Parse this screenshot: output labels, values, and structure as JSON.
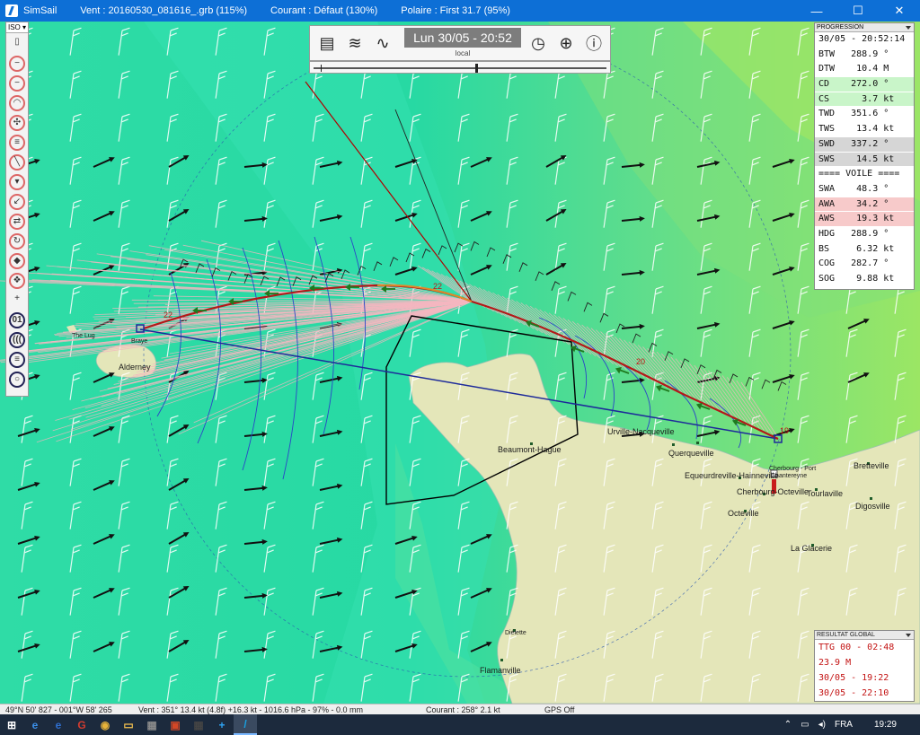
{
  "window": {
    "app_name": "SimSail",
    "wind_file": "Vent : 20160530_081616_.grb (115%)",
    "current": "Courant : Défaut (130%)",
    "polar": "Polaire : First 31.7 (95%)",
    "minimize_glyph": "—",
    "maximize_glyph": "☐",
    "close_glyph": "✕"
  },
  "left_toolbar": {
    "mode_label": "ISO",
    "mode_glyph": "▾",
    "tools": [
      {
        "name": "phone-icon",
        "glyph": "▯"
      },
      {
        "name": "stop-icon",
        "glyph": "−"
      },
      {
        "name": "minus-icon",
        "glyph": "−"
      },
      {
        "name": "speedometer-icon",
        "glyph": "◠"
      },
      {
        "name": "fan-icon",
        "glyph": "✣"
      },
      {
        "name": "windsock-icon",
        "glyph": "≡"
      },
      {
        "name": "pencil-icon",
        "glyph": "╲"
      },
      {
        "name": "cup-icon",
        "glyph": "▾"
      },
      {
        "name": "arrow-diagonal-icon",
        "glyph": "↙"
      },
      {
        "name": "refresh-icon",
        "glyph": "⇄"
      },
      {
        "name": "recycle-icon",
        "glyph": "↻"
      },
      {
        "name": "diamond-icon",
        "glyph": "◆"
      },
      {
        "name": "palette-icon",
        "glyph": "❖"
      },
      {
        "name": "plus-icon",
        "glyph": "+"
      },
      {
        "name": "zero-one-icon",
        "glyph": "01"
      },
      {
        "name": "signal-icon",
        "glyph": "((("
      },
      {
        "name": "stripes-icon",
        "glyph": "≡"
      },
      {
        "name": "ellipse-icon",
        "glyph": "○"
      }
    ]
  },
  "top_toolbar": {
    "date": "Lun 30/05 - 20:52",
    "tz": "local",
    "tools": [
      {
        "name": "clipboard-icon",
        "glyph": "▤"
      },
      {
        "name": "wind-icon",
        "glyph": "≋"
      },
      {
        "name": "waves-icon",
        "glyph": "∿"
      },
      {
        "name": "clock-icon",
        "glyph": "◷"
      },
      {
        "name": "globe-icon",
        "glyph": "⊕"
      },
      {
        "name": "info-icon",
        "glyph": "ⓘ"
      }
    ]
  },
  "progression": {
    "title": "PROGRESSION",
    "time": "30/05 - 20:52:14",
    "rows": [
      {
        "text": "BTW   288.9 °",
        "tone": "white"
      },
      {
        "text": "DTW    10.4 M",
        "tone": "white"
      },
      {
        "text": "CD    272.0 °",
        "tone": "green"
      },
      {
        "text": "CS      3.7 kt",
        "tone": "green"
      },
      {
        "text": "TWD   351.6 °",
        "tone": "white"
      },
      {
        "text": "TWS    13.4 kt",
        "tone": "white"
      },
      {
        "text": "SWD   337.2 °",
        "tone": "grey"
      },
      {
        "text": "SWS    14.5 kt",
        "tone": "grey"
      },
      {
        "text": "==== VOILE ====",
        "tone": "white"
      },
      {
        "text": "SWA    48.3 °",
        "tone": "white"
      },
      {
        "text": "AWA    34.2 °",
        "tone": "pink"
      },
      {
        "text": "AWS    19.3 kt",
        "tone": "pink"
      },
      {
        "text": "HDG   288.9 °",
        "tone": "white"
      },
      {
        "text": "BS     6.32 kt",
        "tone": "white"
      },
      {
        "text": "COG   282.7 °",
        "tone": "white"
      },
      {
        "text": "SOG    9.88 kt",
        "tone": "white"
      }
    ]
  },
  "results": {
    "title": "RESULTAT GLOBAL",
    "rows": [
      "TTG 00 - 02:48",
      "23.9 M",
      "30/05 - 19:22",
      "30/05 - 22:10"
    ]
  },
  "map_labels": [
    {
      "name": "label-alderney",
      "text": "Alderney",
      "cls": ""
    },
    {
      "name": "label-the-lug",
      "text": "The Lug",
      "cls": "small"
    },
    {
      "name": "label-braye",
      "text": "Braye",
      "cls": "small"
    },
    {
      "name": "label-beaumont-hague",
      "text": "Beaumont-Hague",
      "cls": ""
    },
    {
      "name": "label-urville",
      "text": "Urville-Nacqueville",
      "cls": ""
    },
    {
      "name": "label-querqueville",
      "text": "Querqueville",
      "cls": ""
    },
    {
      "name": "label-equeurdreville",
      "text": "Equeurdreville-Hainneville",
      "cls": ""
    },
    {
      "name": "label-cherbourg-port",
      "text": "Cherbourg - Port",
      "cls": "small"
    },
    {
      "name": "label-chantereyne",
      "text": "Chantereyne",
      "cls": "small"
    },
    {
      "name": "label-cherbourg",
      "text": "Cherbourg-Octeville",
      "cls": ""
    },
    {
      "name": "label-tourlaville",
      "text": "Tourlaville",
      "cls": ""
    },
    {
      "name": "label-bretteville",
      "text": "Bretteville",
      "cls": ""
    },
    {
      "name": "label-digosville",
      "text": "Digosville",
      "cls": ""
    },
    {
      "name": "label-octeville",
      "text": "Octeville",
      "cls": ""
    },
    {
      "name": "label-la-glacerie",
      "text": "La Glacerie",
      "cls": ""
    },
    {
      "name": "label-dielette",
      "text": "Diélette",
      "cls": "small"
    },
    {
      "name": "label-flamanville",
      "text": "Flamanville",
      "cls": ""
    }
  ],
  "isochrone_labels": [
    "22",
    "22",
    "20",
    "19"
  ],
  "status_bar": {
    "position": "49°N 50' 827 - 001°W 58' 265",
    "wind": "Vent : 351° 13.4 kt (4.8f) +16.3 kt - 1016.6 hPa - 97% - 0.0 mm",
    "current": "Courant : 258° 2.1 kt",
    "gps": "GPS Off"
  },
  "taskbar": {
    "items": [
      {
        "name": "windows-start-icon",
        "glyph": "⊞",
        "color": "#ffffff"
      },
      {
        "name": "edge-icon",
        "glyph": "e",
        "color": "#3b8fe8"
      },
      {
        "name": "ie-icon",
        "glyph": "e",
        "color": "#2f6fd0"
      },
      {
        "name": "app-red-icon",
        "glyph": "G",
        "color": "#d33c2f"
      },
      {
        "name": "chrome-icon",
        "glyph": "◉",
        "color": "#e7b33a"
      },
      {
        "name": "explorer-icon",
        "glyph": "▭",
        "color": "#f2c04f"
      },
      {
        "name": "photos-icon",
        "glyph": "▦",
        "color": "#8a8a8a"
      },
      {
        "name": "presentation-icon",
        "glyph": "▣",
        "color": "#d24726"
      },
      {
        "name": "calculator-icon",
        "glyph": "▦",
        "color": "#444444"
      },
      {
        "name": "plus-app-icon",
        "glyph": "+",
        "color": "#2ea3f2"
      },
      {
        "name": "simsail-icon",
        "glyph": "/",
        "color": "#19a0e0"
      }
    ],
    "tray_up": "⌃",
    "tray_net": "▭",
    "tray_vol": "◂)",
    "lang": "FRA",
    "clock": "19:29"
  }
}
